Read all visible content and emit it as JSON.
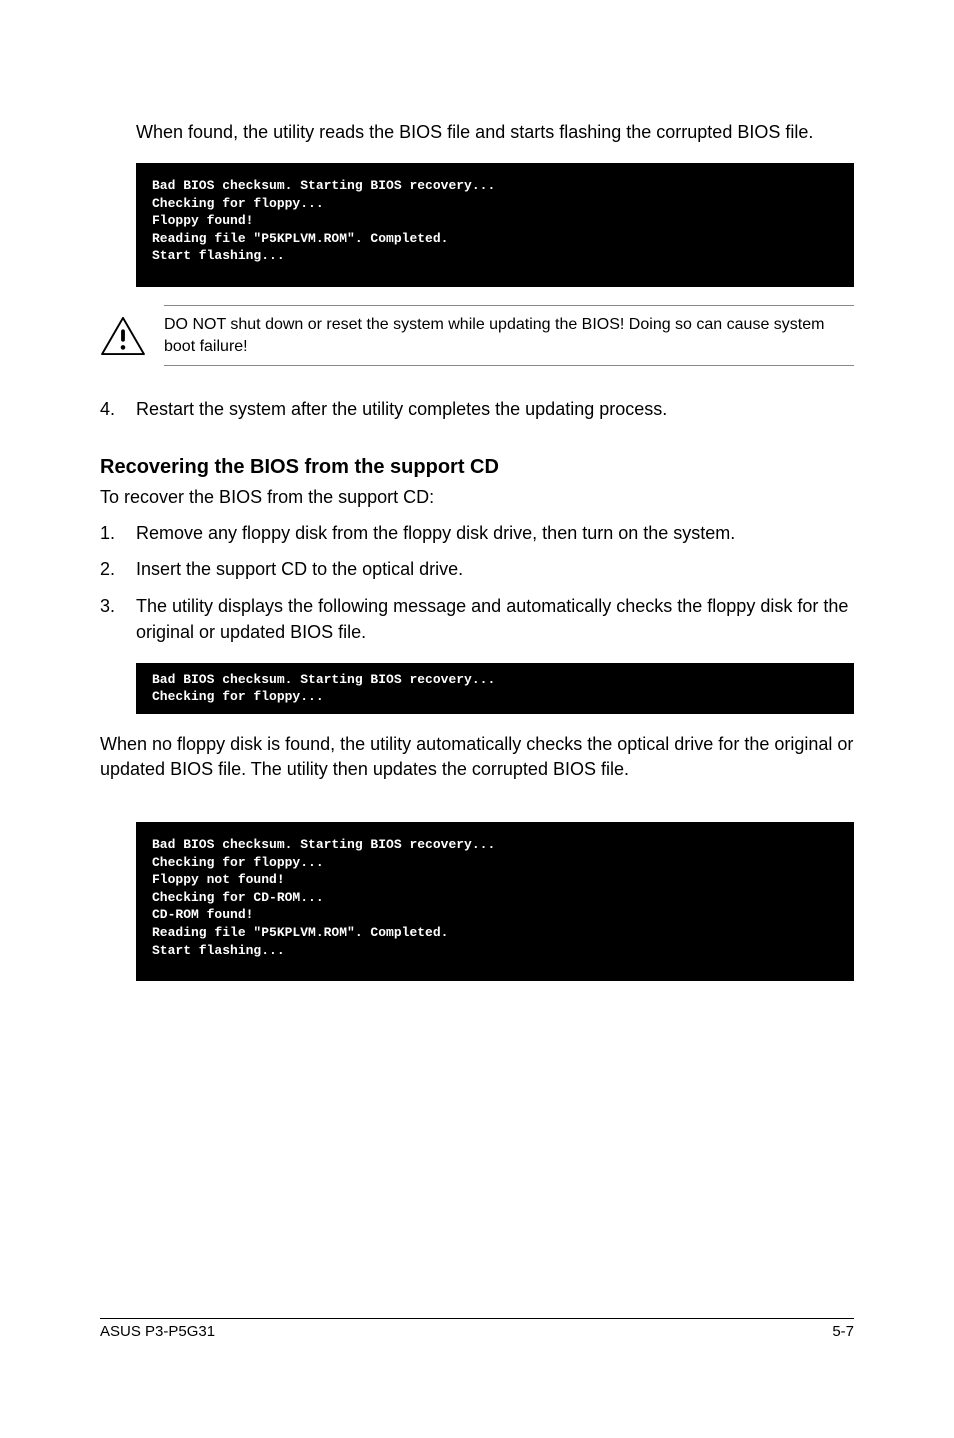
{
  "intro_text": "When found, the utility reads the BIOS file and starts flashing the corrupted BIOS file.",
  "terminal1": "Bad BIOS checksum. Starting BIOS recovery...\nChecking for floppy...\nFloppy found!\nReading file \"P5KPLVM.ROM\". Completed.\nStart flashing...",
  "warning_text": "DO NOT shut down or reset the system while updating the BIOS! Doing so can cause system boot failure!",
  "step4_num": "4.",
  "step4_text": "Restart the system after the utility completes the updating process.",
  "section_heading": "Recovering the BIOS from the support CD",
  "section_intro": "To recover the BIOS from the support CD:",
  "steps": [
    {
      "num": "1.",
      "text": "Remove any floppy disk from the floppy disk drive, then turn on the system."
    },
    {
      "num": "2.",
      "text": "Insert the support CD to the optical drive."
    },
    {
      "num": "3.",
      "text": "The utility displays the following message and automatically checks the floppy disk for the original or updated BIOS file."
    }
  ],
  "terminal2": "Bad BIOS checksum. Starting BIOS recovery...\nChecking for floppy...",
  "mid_text": "When no floppy disk is found, the utility automatically checks the optical drive for the original or updated BIOS file. The utility then updates the corrupted BIOS file.",
  "terminal3": "Bad BIOS checksum. Starting BIOS recovery...\nChecking for floppy...\nFloppy not found!\nChecking for CD-ROM...\nCD-ROM found!\nReading file \"P5KPLVM.ROM\". Completed.\nStart flashing...",
  "footer_left": "ASUS P3-P5G31",
  "footer_right": "5-7"
}
